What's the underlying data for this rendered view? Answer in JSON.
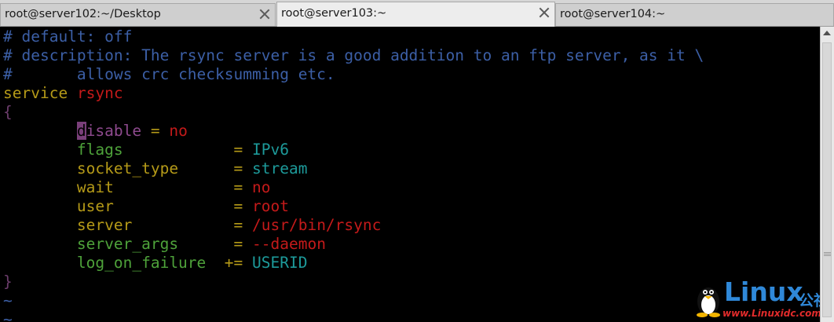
{
  "tabs": [
    {
      "label": "root@server102:~/Desktop",
      "active": false
    },
    {
      "label": "root@server103:~",
      "active": true
    },
    {
      "label": "root@server104:~",
      "active": false
    }
  ],
  "terminal": {
    "comment_1": "# default: off",
    "comment_2": "# description: The rsync server is a good addition to an ftp server, as it \\",
    "comment_3_hash": "#",
    "comment_3_text": "       allows crc checksumming etc.",
    "service_kw": "service",
    "service_name": "rsync",
    "open_brace": "{",
    "close_brace": "}",
    "cursor_char": "d",
    "disable_rest": "isable",
    "disable_eq": "=",
    "disable_val": "no",
    "settings": [
      {
        "key": "flags",
        "op": "=",
        "value": "IPv6",
        "key_color": "grn",
        "val_color": "cyan"
      },
      {
        "key": "socket_type",
        "op": "=",
        "value": "stream",
        "key_color": "kw",
        "val_color": "cyan"
      },
      {
        "key": "wait",
        "op": "=",
        "value": "no",
        "key_color": "kw",
        "val_color": "red"
      },
      {
        "key": "user",
        "op": "=",
        "value": "root",
        "key_color": "kw",
        "val_color": "red"
      },
      {
        "key": "server",
        "op": "=",
        "value": "/usr/bin/rsync",
        "key_color": "kw",
        "val_color": "red"
      },
      {
        "key": "server_args",
        "op": "=",
        "value": "--daemon",
        "key_color": "grn",
        "val_color": "red"
      },
      {
        "key": "log_on_failure",
        "op": "+=",
        "value": "USERID",
        "key_color": "grn",
        "val_color": "cyan"
      }
    ],
    "tilde": "~"
  },
  "watermark": {
    "brand": "Linux",
    "chinese": "公社",
    "url": "www.Linuxidc.com"
  },
  "colors": {
    "comment": "#3c5fa6",
    "keyword": "#b59a18",
    "string_red": "#c41a1a",
    "cyan": "#1d9a9a",
    "green": "#4ea23a",
    "background": "#000000"
  },
  "icons": [
    "close-icon",
    "scroll-up-icon",
    "tux-penguin-icon"
  ]
}
